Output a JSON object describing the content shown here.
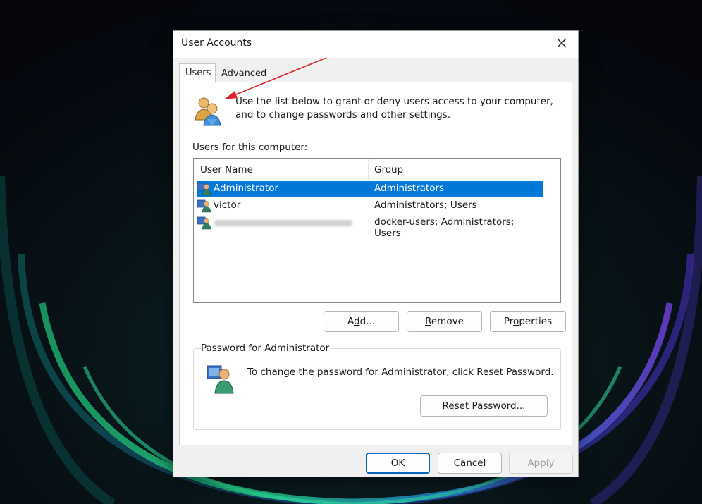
{
  "dialog": {
    "title": "User Accounts",
    "tabs": [
      {
        "label": "Users",
        "active": true
      },
      {
        "label": "Advanced",
        "active": false
      }
    ],
    "intro_text": "Use the list below to grant or deny users access to your computer, and to change passwords and other settings.",
    "users_label": "Users for this computer:",
    "columns": [
      "User Name",
      "Group"
    ],
    "rows": [
      {
        "name": "Administrator",
        "group": "Administrators",
        "selected": true
      },
      {
        "name": "victor",
        "group": "Administrators; Users",
        "selected": false
      },
      {
        "name": "",
        "group": "docker-users; Administrators; Users",
        "selected": false,
        "name_redacted": true
      }
    ],
    "buttons": {
      "add": {
        "pre": "A",
        "key": "d",
        "post": "d..."
      },
      "remove": {
        "pre": "",
        "key": "R",
        "post": "emove"
      },
      "properties": {
        "pre": "Pr",
        "key": "o",
        "post": "perties"
      }
    },
    "password_group": {
      "legend": "Password for Administrator",
      "text": "To change the password for Administrator, click Reset Password.",
      "reset": {
        "pre": "Reset ",
        "key": "P",
        "post": "assword..."
      }
    },
    "footer": {
      "ok": "OK",
      "cancel": "Cancel",
      "apply": "Apply"
    }
  },
  "icons": {
    "close": "close-icon",
    "users_group": "users-group-icon",
    "user": "user-icon",
    "password_user": "user-password-icon",
    "annotation": "red-arrow-annotation"
  },
  "colors": {
    "selection": "#0078d7",
    "annotation_arrow": "#d9262b",
    "default_button_border": "#0067c0"
  }
}
